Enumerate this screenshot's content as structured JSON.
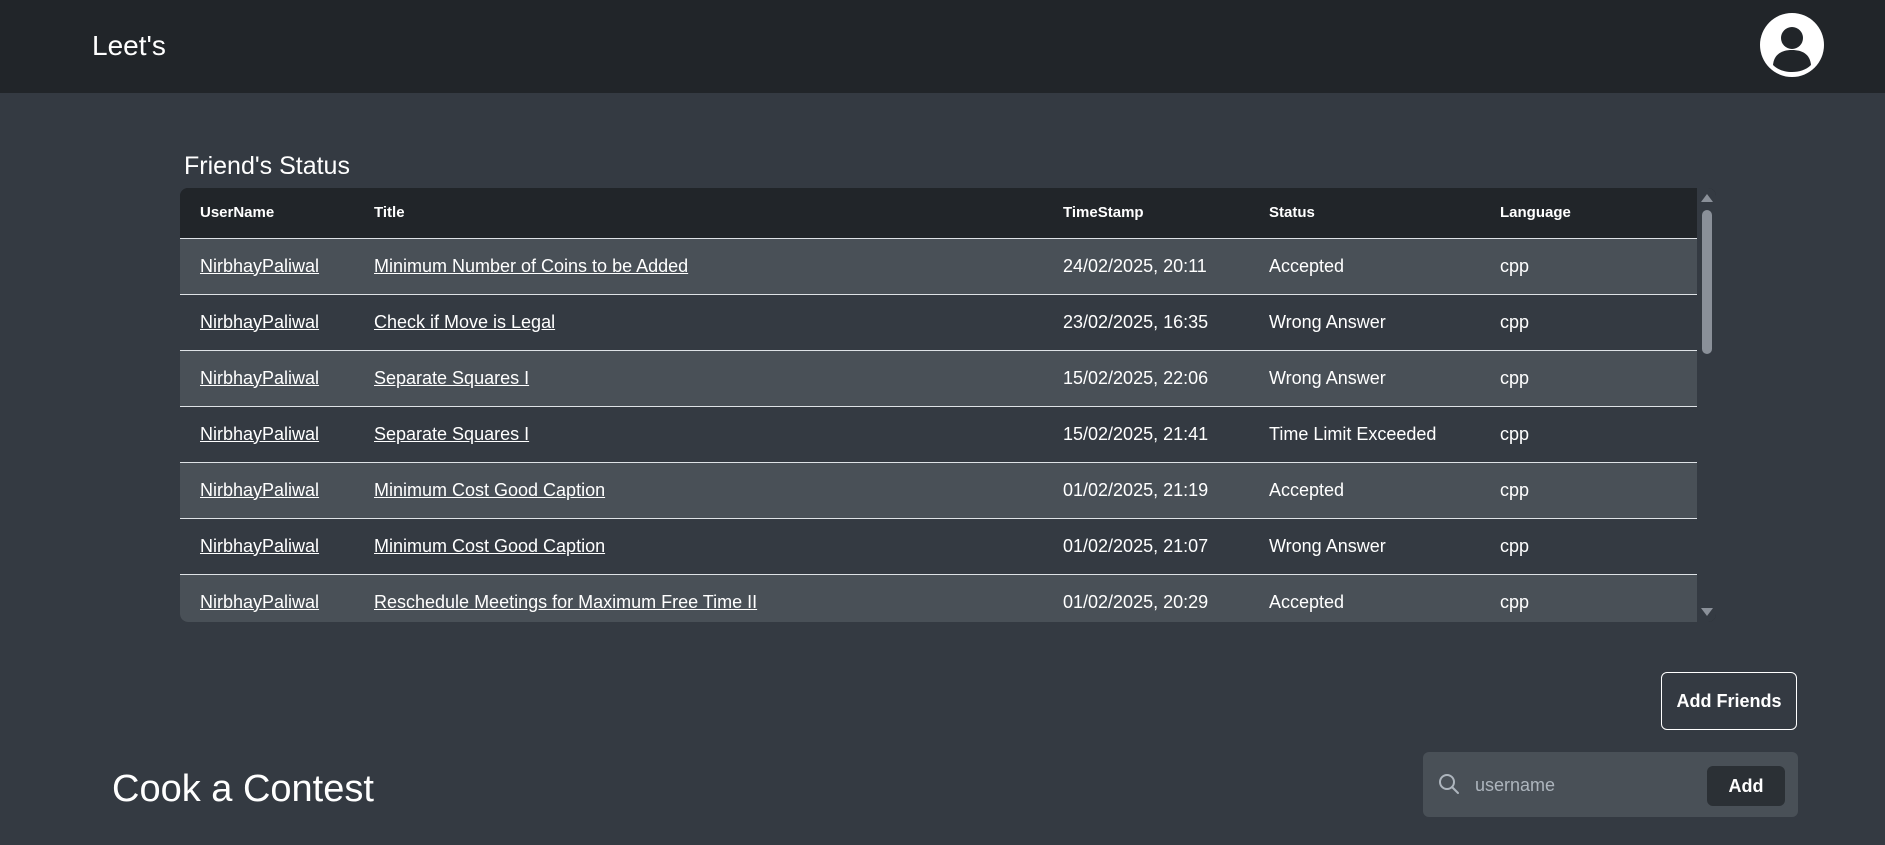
{
  "navbar": {
    "brand": "Leet's",
    "avatar_icon": "user-avatar-icon"
  },
  "friends_status": {
    "title": "Friend's Status",
    "columns": [
      "UserName",
      "Title",
      "TimeStamp",
      "Status",
      "Language"
    ],
    "rows": [
      {
        "username": "NirbhayPaliwal",
        "title": "Minimum Number of Coins to be Added",
        "timestamp": "24/02/2025, 20:11",
        "status": "Accepted",
        "language": "cpp"
      },
      {
        "username": "NirbhayPaliwal",
        "title": "Check if Move is Legal",
        "timestamp": "23/02/2025, 16:35",
        "status": "Wrong Answer",
        "language": "cpp"
      },
      {
        "username": "NirbhayPaliwal",
        "title": "Separate Squares I",
        "timestamp": "15/02/2025, 22:06",
        "status": "Wrong Answer",
        "language": "cpp"
      },
      {
        "username": "NirbhayPaliwal",
        "title": "Separate Squares I",
        "timestamp": "15/02/2025, 21:41",
        "status": "Time Limit Exceeded",
        "language": "cpp"
      },
      {
        "username": "NirbhayPaliwal",
        "title": "Minimum Cost Good Caption",
        "timestamp": "01/02/2025, 21:19",
        "status": "Accepted",
        "language": "cpp"
      },
      {
        "username": "NirbhayPaliwal",
        "title": "Minimum Cost Good Caption",
        "timestamp": "01/02/2025, 21:07",
        "status": "Wrong Answer",
        "language": "cpp"
      },
      {
        "username": "NirbhayPaliwal",
        "title": "Reschedule Meetings for Maximum Free Time II",
        "timestamp": "01/02/2025, 20:29",
        "status": "Accepted",
        "language": "cpp"
      }
    ]
  },
  "add_friends": {
    "button_label": "Add Friends",
    "search_placeholder": "username",
    "search_value": "",
    "add_label": "Add",
    "search_icon": "search-icon"
  },
  "contest": {
    "title": "Cook a Contest"
  },
  "colors": {
    "navbar_bg": "#212529",
    "page_bg": "#343a42",
    "row_alt_bg": "#495057"
  }
}
